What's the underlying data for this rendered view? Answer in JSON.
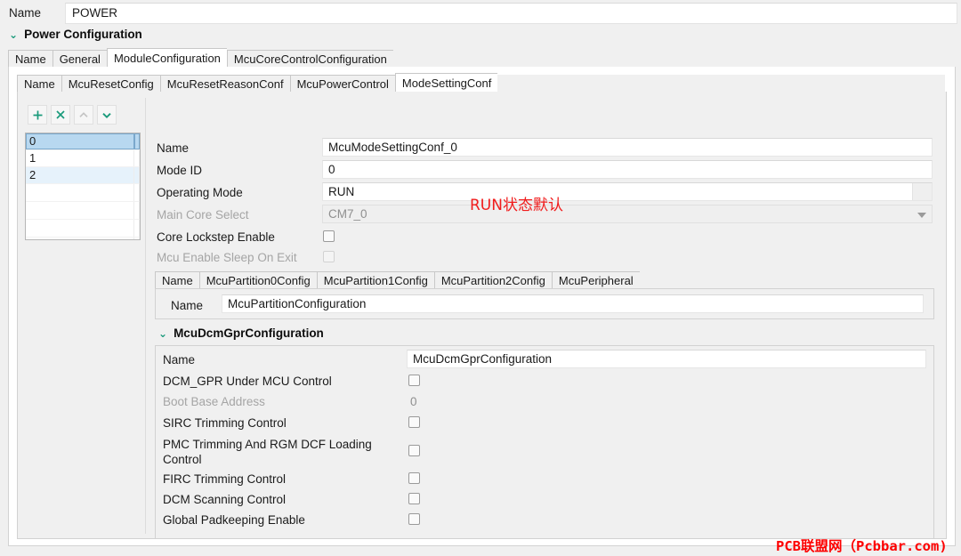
{
  "top": {
    "name_label": "Name",
    "name_value": "POWER"
  },
  "section": {
    "chevron": "⌄",
    "title": "Power Configuration"
  },
  "tabs_level1": [
    {
      "label": "Name",
      "active": false
    },
    {
      "label": "General",
      "active": false
    },
    {
      "label": "ModuleConfiguration",
      "active": true
    },
    {
      "label": "McuCoreControlConfiguration",
      "active": false
    }
  ],
  "tabs_level2": [
    {
      "label": "Name",
      "active": false
    },
    {
      "label": "McuResetConfig",
      "active": false
    },
    {
      "label": "McuResetReasonConf",
      "active": false
    },
    {
      "label": "McuPowerControl",
      "active": false
    },
    {
      "label": "ModeSettingConf",
      "active": true
    }
  ],
  "toolbar": {
    "add_label": "+",
    "delete_label": "×",
    "up_label": "⌃",
    "down_label": "⌄"
  },
  "list": {
    "items": [
      "0",
      "1",
      "2"
    ],
    "selected_index": 0
  },
  "mode_form": {
    "rows": [
      {
        "label": "Name",
        "value": "McuModeSettingConf_0",
        "kind": "text",
        "disabled": false
      },
      {
        "label": "Mode ID",
        "value": "0",
        "kind": "text",
        "disabled": false
      },
      {
        "label": "Operating Mode",
        "value": "RUN",
        "kind": "combo-open",
        "disabled": false
      },
      {
        "label": "Main Core Select",
        "value": "CM7_0",
        "kind": "combo",
        "disabled": true
      },
      {
        "label": "Core Lockstep Enable",
        "value": "",
        "kind": "checkbox",
        "disabled": false,
        "checked": false
      },
      {
        "label": "Mcu Enable Sleep On Exit",
        "value": "",
        "kind": "checkbox",
        "disabled": true,
        "checked": false
      }
    ]
  },
  "annotation": {
    "text": "RUN状态默认"
  },
  "tabs_level3": [
    {
      "label": "Name",
      "active": false
    },
    {
      "label": "McuPartition0Config",
      "active": false
    },
    {
      "label": "McuPartition1Config",
      "active": false
    },
    {
      "label": "McuPartition2Config",
      "active": false
    },
    {
      "label": "McuPeripheral",
      "active": false
    }
  ],
  "partition": {
    "name_label": "Name",
    "name_value": "McuPartitionConfiguration"
  },
  "dcm_section": {
    "chevron": "⌄",
    "title": "McuDcmGprConfiguration"
  },
  "dcm_form": {
    "rows": [
      {
        "label": "Name",
        "value": "McuDcmGprConfiguration",
        "kind": "text",
        "disabled": false
      },
      {
        "label": "DCM_GPR Under MCU Control",
        "value": "",
        "kind": "checkbox",
        "disabled": false,
        "checked": false
      },
      {
        "label": "Boot Base Address",
        "value": "0",
        "kind": "plain",
        "disabled": true
      },
      {
        "label": "SIRC Trimming Control",
        "value": "",
        "kind": "checkbox",
        "disabled": false,
        "checked": false
      },
      {
        "label": "PMC Trimming And RGM DCF Loading Control",
        "value": "",
        "kind": "checkbox",
        "disabled": false,
        "checked": false
      },
      {
        "label": "FIRC Trimming Control",
        "value": "",
        "kind": "checkbox",
        "disabled": false,
        "checked": false
      },
      {
        "label": "DCM Scanning Control",
        "value": "",
        "kind": "checkbox",
        "disabled": false,
        "checked": false
      },
      {
        "label": "Global Padkeeping Enable",
        "value": "",
        "kind": "checkbox",
        "disabled": false,
        "checked": false
      }
    ]
  },
  "watermark": {
    "text": "PCB联盟网（Pcbbar.com)"
  },
  "colors": {
    "accent": "#1a9a7b",
    "selection": "#b8d8f0",
    "alt_row": "#e6f2fb",
    "annotation": "#f01c1c",
    "watermark": "#fd0000",
    "background": "#f0f0f0"
  }
}
